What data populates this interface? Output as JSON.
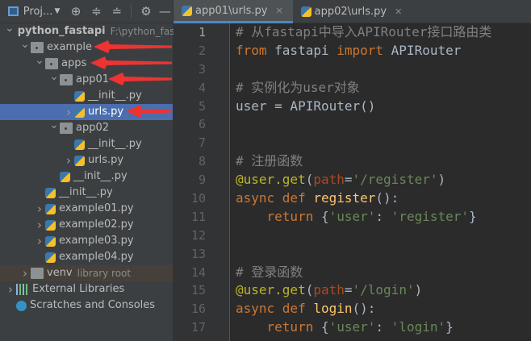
{
  "toolbar": {
    "project_label": "Proj...",
    "icons": [
      "target-icon",
      "expand-all-icon",
      "collapse-all-icon",
      "gear-icon",
      "minimize-icon"
    ]
  },
  "tree": [
    {
      "label": "python_fastapi",
      "hint": "F:\\python_fas",
      "depth": 0,
      "chev": "v",
      "icon": "folder",
      "bold": true
    },
    {
      "label": "example",
      "depth": 1,
      "chev": "v",
      "icon": "pkg"
    },
    {
      "label": "apps",
      "depth": 2,
      "chev": "v",
      "icon": "pkg"
    },
    {
      "label": "app01",
      "depth": 3,
      "chev": "v",
      "icon": "pkg"
    },
    {
      "label": "__init__.py",
      "depth": 4,
      "chev": "",
      "icon": "py"
    },
    {
      "label": "urls.py",
      "depth": 4,
      "chev": ">",
      "icon": "py",
      "selected": true
    },
    {
      "label": "app02",
      "depth": 3,
      "chev": "v",
      "icon": "pkg"
    },
    {
      "label": "__init__.py",
      "depth": 4,
      "chev": "",
      "icon": "py"
    },
    {
      "label": "urls.py",
      "depth": 4,
      "chev": ">",
      "icon": "py"
    },
    {
      "label": "__init__.py",
      "depth": 3,
      "chev": "",
      "icon": "py"
    },
    {
      "label": "__init__.py",
      "depth": 2,
      "chev": "",
      "icon": "py"
    },
    {
      "label": "example01.py",
      "depth": 2,
      "chev": ">",
      "icon": "py"
    },
    {
      "label": "example02.py",
      "depth": 2,
      "chev": ">",
      "icon": "py"
    },
    {
      "label": "example03.py",
      "depth": 2,
      "chev": ">",
      "icon": "py"
    },
    {
      "label": "example04.py",
      "depth": 2,
      "chev": "",
      "icon": "py"
    },
    {
      "label": "venv",
      "hint": "library root",
      "depth": 1,
      "chev": ">",
      "icon": "folder",
      "lib": true
    },
    {
      "label": "External Libraries",
      "depth": 0,
      "chev": ">",
      "icon": "libs"
    },
    {
      "label": "Scratches and Consoles",
      "depth": 0,
      "chev": "",
      "icon": "scratch"
    }
  ],
  "tabs": [
    {
      "label": "app01\\urls.py",
      "active": true
    },
    {
      "label": "app02\\urls.py",
      "active": false
    }
  ],
  "code": [
    [
      [
        "# 从fastapi中导入APIRouter接口路由类",
        "comment"
      ]
    ],
    [
      [
        "from",
        "kw"
      ],
      [
        " fastapi ",
        "plain"
      ],
      [
        "import",
        "kw"
      ],
      [
        " APIRouter",
        "plain"
      ]
    ],
    [],
    [
      [
        "# 实例化为user对象",
        "comment"
      ]
    ],
    [
      [
        "user = APIRouter()",
        "plain"
      ]
    ],
    [],
    [],
    [
      [
        "# 注册函数",
        "comment"
      ]
    ],
    [
      [
        "@user.get",
        "dec"
      ],
      [
        "(",
        "plain"
      ],
      [
        "path",
        "param"
      ],
      [
        "=",
        "plain"
      ],
      [
        "'/register'",
        "str"
      ],
      [
        ")",
        "plain"
      ]
    ],
    [
      [
        "async def ",
        "kw"
      ],
      [
        "register",
        "fn"
      ],
      [
        "():",
        "plain"
      ]
    ],
    [
      [
        "    ",
        "plain"
      ],
      [
        "return ",
        "kw"
      ],
      [
        "{",
        "plain"
      ],
      [
        "'user'",
        "str"
      ],
      [
        ": ",
        "plain"
      ],
      [
        "'register'",
        "str"
      ],
      [
        "}",
        "plain"
      ]
    ],
    [],
    [],
    [
      [
        "# 登录函数",
        "comment"
      ]
    ],
    [
      [
        "@user.get",
        "dec"
      ],
      [
        "(",
        "plain"
      ],
      [
        "path",
        "param"
      ],
      [
        "=",
        "plain"
      ],
      [
        "'/login'",
        "str"
      ],
      [
        ")",
        "plain"
      ]
    ],
    [
      [
        "async def ",
        "kw"
      ],
      [
        "login",
        "fn"
      ],
      [
        "():",
        "plain"
      ]
    ],
    [
      [
        "    ",
        "plain"
      ],
      [
        "return ",
        "kw"
      ],
      [
        "{",
        "plain"
      ],
      [
        "'user'",
        "str"
      ],
      [
        ": ",
        "plain"
      ],
      [
        "'login'",
        "str"
      ],
      [
        "}",
        "plain"
      ]
    ]
  ],
  "colors": {
    "arrow": "#ee3333",
    "selection": "#4b6eaf"
  }
}
